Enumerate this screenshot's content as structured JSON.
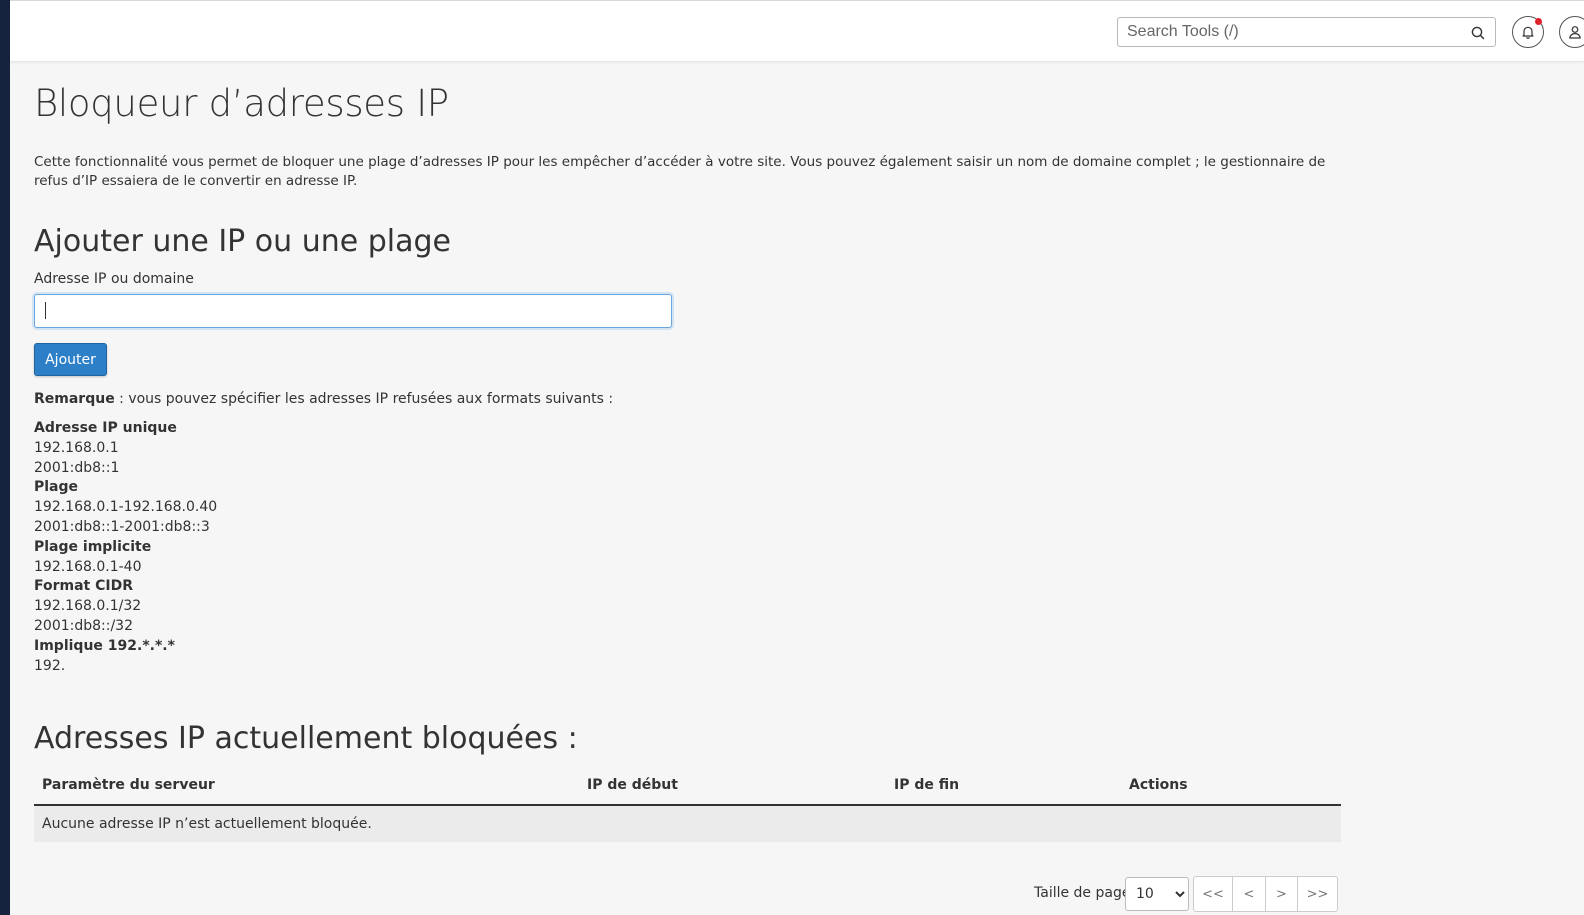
{
  "header": {
    "search_placeholder": "Search Tools (/)"
  },
  "page": {
    "title": "Bloqueur d’adresses IP",
    "intro": "Cette fonctionnalité vous permet de bloquer une plage d’adresses IP pour les empêcher d’accéder à votre site. Vous pouvez également saisir un nom de domaine complet ; le gestionnaire de refus d’IP essaiera de le convertir en adresse IP."
  },
  "add_section": {
    "heading": "Ajouter une IP ou une plage",
    "field_label": "Adresse IP ou domaine",
    "field_value": "",
    "add_button": "Ajouter",
    "note_bold": "Remarque",
    "note_text": " : vous pouvez spécifier les adresses IP refusées aux formats suivants :"
  },
  "formats": [
    {
      "title": "Adresse IP unique",
      "examples": [
        "192.168.0.1",
        "2001:db8::1"
      ]
    },
    {
      "title": "Plage",
      "examples": [
        "192.168.0.1-192.168.0.40",
        "2001:db8::1-2001:db8::3"
      ]
    },
    {
      "title": "Plage implicite",
      "examples": [
        "192.168.0.1-40"
      ]
    },
    {
      "title": "Format CIDR",
      "examples": [
        "192.168.0.1/32",
        "2001:db8::/32"
      ]
    },
    {
      "title": "Implique 192.*.*.*",
      "examples": [
        "192."
      ]
    }
  ],
  "blocked_section": {
    "heading": "Adresses IP actuellement bloquées :",
    "columns": [
      "Paramètre du serveur",
      "IP de début",
      "IP de fin",
      "Actions"
    ],
    "empty_message": "Aucune adresse IP n’est actuellement bloquée."
  },
  "pagination": {
    "page_size_label": "Taille de page",
    "page_size_value": "10",
    "first": "<<",
    "prev": "<",
    "next": ">",
    "last": ">>"
  },
  "colors": {
    "sidebar": "#15233f",
    "primary_button": "#2d7fc7",
    "notification_dot": "#e0222c"
  },
  "icons": [
    "search-icon",
    "bell-icon",
    "user-icon"
  ]
}
